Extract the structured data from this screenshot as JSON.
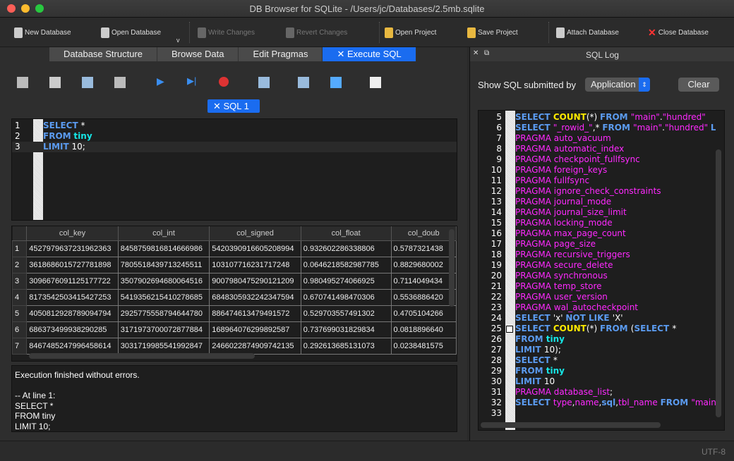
{
  "window": {
    "title": "DB Browser for SQLite - /Users/jc/Databases/2.5mb.sqlite"
  },
  "toolbar": [
    {
      "label": "New Database",
      "enabled": true
    },
    {
      "label": "Open Database",
      "enabled": true
    },
    {
      "label": "Write Changes",
      "enabled": false
    },
    {
      "label": "Revert Changes",
      "enabled": false
    },
    {
      "label": "Open Project",
      "enabled": true
    },
    {
      "label": "Save Project",
      "enabled": true
    },
    {
      "label": "Attach Database",
      "enabled": true
    },
    {
      "label": "Close Database",
      "enabled": true
    }
  ],
  "tabs": [
    "Database Structure",
    "Browse Data",
    "Edit Pragmas",
    "Execute SQL"
  ],
  "active_tab": "Execute SQL",
  "sql_tab": "SQL 1",
  "editor": {
    "lines": [
      [
        [
          "k",
          "SELECT"
        ],
        [
          "n",
          " *"
        ]
      ],
      [
        [
          "k",
          "FROM"
        ],
        [
          "n",
          " "
        ],
        [
          "t",
          "tiny"
        ]
      ],
      [
        [
          "k",
          "LIMIT"
        ],
        [
          "n",
          " 10;"
        ]
      ]
    ]
  },
  "grid": {
    "columns": [
      "col_key",
      "col_int",
      "col_signed",
      "col_float",
      "col_doub"
    ],
    "rows": [
      [
        "1",
        "4527979637231962363",
        "8458759816814666986",
        "5420390916605208994",
        "0.932602286338806",
        "0.5787321438"
      ],
      [
        "2",
        "3618686015727781898",
        "7805518439713245511",
        "103107716231717248",
        "0.0646218582987785",
        "0.8829680002"
      ],
      [
        "3",
        "3096676091125177722",
        "3507902694680064516",
        "9007980475290121209",
        "0.980495274066925",
        "0.7114049434"
      ],
      [
        "4",
        "8173542503415427253",
        "5419356215410278685",
        "6848305932242347594",
        "0.670741498470306",
        "0.5536886420"
      ],
      [
        "5",
        "4050812928789094794",
        "2925775558794644780",
        "886474613479491572",
        "0.529703557491302",
        "0.4705104266"
      ],
      [
        "6",
        "686373499938290285",
        "3171973700072877884",
        "168964076299892587",
        "0.737699031829834",
        "0.0818896640"
      ],
      [
        "7",
        "8467485247996458614",
        "3031719985541992847",
        "2466022874909742135",
        "0.292613685131073",
        "0.0238481575"
      ]
    ]
  },
  "message": "Execution finished without errors.\n\n-- At line 1:\nSELECT *\nFROM tiny\nLIMIT 10;",
  "sql_log": {
    "title": "SQL Log",
    "filter_label": "Show SQL submitted by",
    "filter_value": "Application",
    "clear_label": "Clear",
    "lines": [
      {
        "n": "5",
        "t": [
          [
            "k",
            "SELECT "
          ],
          [
            "f",
            "COUNT"
          ],
          [
            "n",
            "(*) "
          ],
          [
            "k",
            "FROM "
          ],
          [
            "s",
            "\"main\""
          ],
          [
            "n",
            "."
          ],
          [
            "s",
            "\"hundred\""
          ]
        ]
      },
      {
        "n": "6",
        "t": [
          [
            "k",
            "SELECT "
          ],
          [
            "s",
            "\"_rowid_\""
          ],
          [
            "n",
            ",* "
          ],
          [
            "k",
            "FROM "
          ],
          [
            "s",
            "\"main\""
          ],
          [
            "n",
            "."
          ],
          [
            "s",
            "\"hundred\" "
          ],
          [
            "k",
            "LIM"
          ]
        ]
      },
      {
        "n": "7",
        "t": [
          [
            "s",
            "PRAGMA auto_vacuum"
          ]
        ]
      },
      {
        "n": "8",
        "t": [
          [
            "s",
            "PRAGMA automatic_index"
          ]
        ]
      },
      {
        "n": "9",
        "t": [
          [
            "s",
            "PRAGMA checkpoint_fullfsync"
          ]
        ]
      },
      {
        "n": "10",
        "t": [
          [
            "s",
            "PRAGMA foreign_keys"
          ]
        ]
      },
      {
        "n": "11",
        "t": [
          [
            "s",
            "PRAGMA fullfsync"
          ]
        ]
      },
      {
        "n": "12",
        "t": [
          [
            "s",
            "PRAGMA ignore_check_constraints"
          ]
        ]
      },
      {
        "n": "13",
        "t": [
          [
            "s",
            "PRAGMA journal_mode"
          ]
        ]
      },
      {
        "n": "14",
        "t": [
          [
            "s",
            "PRAGMA journal_size_limit"
          ]
        ]
      },
      {
        "n": "15",
        "t": [
          [
            "s",
            "PRAGMA locking_mode"
          ]
        ]
      },
      {
        "n": "16",
        "t": [
          [
            "s",
            "PRAGMA max_page_count"
          ]
        ]
      },
      {
        "n": "17",
        "t": [
          [
            "s",
            "PRAGMA page_size"
          ]
        ]
      },
      {
        "n": "18",
        "t": [
          [
            "s",
            "PRAGMA recursive_triggers"
          ]
        ]
      },
      {
        "n": "19",
        "t": [
          [
            "s",
            "PRAGMA secure_delete"
          ]
        ]
      },
      {
        "n": "20",
        "t": [
          [
            "s",
            "PRAGMA synchronous"
          ]
        ]
      },
      {
        "n": "21",
        "t": [
          [
            "s",
            "PRAGMA temp_store"
          ]
        ]
      },
      {
        "n": "22",
        "t": [
          [
            "s",
            "PRAGMA user_version"
          ]
        ]
      },
      {
        "n": "23",
        "t": [
          [
            "s",
            "PRAGMA wal_autocheckpoint"
          ]
        ]
      },
      {
        "n": "24",
        "t": [
          [
            "k",
            "SELECT "
          ],
          [
            "n",
            "'x' "
          ],
          [
            "k",
            "NOT LIKE "
          ],
          [
            "n",
            "'X'"
          ]
        ]
      },
      {
        "n": "25",
        "t": [
          [
            "k",
            "SELECT "
          ],
          [
            "f",
            "COUNT"
          ],
          [
            "n",
            "(*) "
          ],
          [
            "k",
            "FROM "
          ],
          [
            "n",
            "("
          ],
          [
            "k",
            "SELECT "
          ],
          [
            "n",
            "*"
          ]
        ]
      },
      {
        "n": "26",
        "t": [
          [
            "k",
            "FROM "
          ],
          [
            "t",
            "tiny"
          ]
        ]
      },
      {
        "n": "27",
        "t": [
          [
            "k",
            "LIMIT "
          ],
          [
            "n",
            "10);"
          ]
        ]
      },
      {
        "n": "28",
        "t": [
          [
            "k",
            "SELECT "
          ],
          [
            "n",
            "*"
          ]
        ]
      },
      {
        "n": "29",
        "t": [
          [
            "k",
            "FROM "
          ],
          [
            "t",
            "tiny"
          ]
        ]
      },
      {
        "n": "30",
        "t": [
          [
            "k",
            "LIMIT "
          ],
          [
            "n",
            "10"
          ]
        ]
      },
      {
        "n": "31",
        "t": [
          [
            "s",
            "PRAGMA database_list"
          ],
          [
            "n",
            ";"
          ]
        ]
      },
      {
        "n": "32",
        "t": [
          [
            "k",
            "SELECT "
          ],
          [
            "s",
            "type"
          ],
          [
            "n",
            ","
          ],
          [
            "s",
            "name"
          ],
          [
            "n",
            ","
          ],
          [
            "k",
            "sql"
          ],
          [
            "n",
            ","
          ],
          [
            "s",
            "tbl_name "
          ],
          [
            "k",
            "FROM "
          ],
          [
            "s",
            "\"main\""
          ],
          [
            "n",
            "."
          ],
          [
            "s",
            "s"
          ]
        ]
      },
      {
        "n": "33",
        "t": []
      }
    ]
  },
  "status": {
    "encoding": "UTF-8"
  },
  "colors": {
    "accent": "#1a6cf0",
    "keyword": "#5b9bf0",
    "string": "#ff29ff",
    "table": "#16e6e6",
    "function": "#ffea00"
  }
}
